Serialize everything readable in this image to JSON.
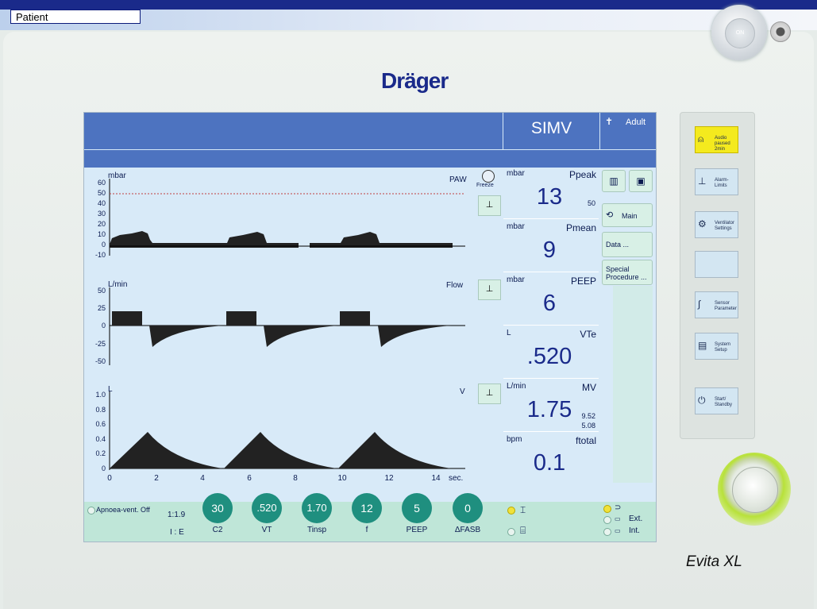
{
  "patient_tab": "Patient",
  "brand": "Dräger",
  "model": "Evita XL",
  "on_button": "ON",
  "header": {
    "mode": "SIMV",
    "patient_type": "Adult"
  },
  "waveforms": [
    {
      "unit": "mbar",
      "name": "PAW",
      "ticks": [
        "60",
        "50",
        "40",
        "30",
        "20",
        "10",
        "0",
        "-10"
      ]
    },
    {
      "unit": "L/min",
      "name": "Flow",
      "ticks": [
        "50",
        "25",
        "0",
        "-25",
        "-50"
      ]
    },
    {
      "unit": "L",
      "name": "V",
      "ticks": [
        "1.0",
        "0.8",
        "0.6",
        "0.4",
        "0.2",
        "0"
      ]
    }
  ],
  "time_axis": {
    "ticks": [
      "0",
      "2",
      "4",
      "6",
      "8",
      "10",
      "12",
      "14"
    ],
    "unit": "sec."
  },
  "freeze_label": "Freeze",
  "measured": [
    {
      "unit": "mbar",
      "name": "Ppeak",
      "value": "13",
      "limit_hi": "50",
      "limit_lo": ""
    },
    {
      "unit": "mbar",
      "name": "Pmean",
      "value": "9",
      "limit_hi": "",
      "limit_lo": ""
    },
    {
      "unit": "mbar",
      "name": "PEEP",
      "value": "6",
      "limit_hi": "",
      "limit_lo": ""
    },
    {
      "unit": "L",
      "name": "VTe",
      "value": ".520",
      "limit_hi": "",
      "limit_lo": ""
    },
    {
      "unit": "L/min",
      "name": "MV",
      "value": "1.75",
      "limit_hi": "9.52",
      "limit_lo": "5.08"
    },
    {
      "unit": "bpm",
      "name": "ftotal",
      "value": "0.1",
      "limit_hi": "",
      "limit_lo": ""
    }
  ],
  "right_menu": {
    "main": "Main",
    "data": "Data ...",
    "special": "Special Procedure ..."
  },
  "bottom": {
    "apnoea": "Apnoea-vent. Off",
    "ie_value": "1:1.9",
    "ie_label": "I : E",
    "settings": [
      {
        "value": "30",
        "label": "C2"
      },
      {
        "value": ".520",
        "label": "VT"
      },
      {
        "value": "1.70",
        "label": "Tinsp"
      },
      {
        "value": "12",
        "label": "f"
      },
      {
        "value": "5",
        "label": "PEEP"
      },
      {
        "value": "0",
        "label": "ΔFASB"
      }
    ],
    "ext": "Ext.",
    "int": "Int."
  },
  "side_buttons": {
    "audio": "Audio paused 2min",
    "alarm": "Alarm-Limits",
    "vent": "Ventilator Settings",
    "sensor": "Sensor Parameter",
    "system": "System Setup",
    "start": "Start/ Standby"
  },
  "colors": {
    "screen_bg": "#d8eaf8",
    "header": "#4d73c0",
    "knob": "#1f8f7f",
    "audio_btn": "#f4ea1e"
  }
}
